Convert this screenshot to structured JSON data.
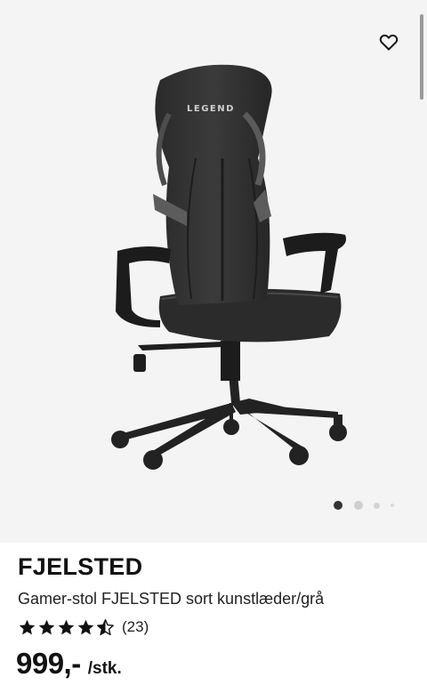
{
  "gallery": {
    "logo_text": "LEGEND",
    "favorite_icon": "heart-outline-icon",
    "pager": {
      "count": 4,
      "active_index": 0
    }
  },
  "product": {
    "name": "FJELSTED",
    "description": "Gamer-stol FJELSTED sort kunstlæder/grå",
    "rating": {
      "stars": 4.5,
      "max": 5,
      "count_text": "(23)"
    },
    "price": "999,-",
    "unit": "/stk."
  },
  "colors": {
    "gallery_bg": "#f4f4f4",
    "star": "#111111",
    "text": "#111111"
  }
}
